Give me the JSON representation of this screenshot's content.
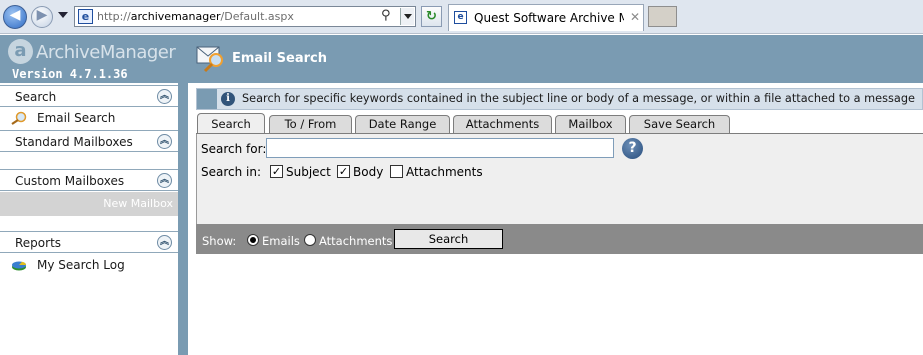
{
  "browser": {
    "url_prefix": "http://",
    "url_host": "archivemanager",
    "url_path": "/Default.aspx",
    "tab_title": "Quest Software Archive Man...",
    "tab_close": "✕"
  },
  "app": {
    "logo_letter": "a",
    "logo_name": "ArchiveManager",
    "version": "Version 4.7.1.36",
    "page_title": "Email Search"
  },
  "sidebar": {
    "sections": [
      {
        "label": "Search",
        "items": [
          {
            "label": "Email Search",
            "icon": "magnifier-icon"
          }
        ]
      },
      {
        "label": "Standard Mailboxes",
        "items": []
      },
      {
        "label": "Custom Mailboxes",
        "items": [
          {
            "label": "New Mailbox"
          }
        ]
      },
      {
        "label": "Reports",
        "items": [
          {
            "label": "My Search Log",
            "icon": "report-icon"
          }
        ]
      }
    ],
    "collapse_glyph": "︽"
  },
  "main": {
    "info_text": "Search for specific keywords contained in the subject line or body of a message, or within a file attached to a message",
    "tabs": [
      {
        "label": "Search",
        "active": true
      },
      {
        "label": "To / From",
        "active": false
      },
      {
        "label": "Date Range",
        "active": false
      },
      {
        "label": "Attachments",
        "active": false
      },
      {
        "label": "Mailbox",
        "active": false
      },
      {
        "label": "Save Search",
        "active": false
      }
    ],
    "form": {
      "search_for_label": "Search for:",
      "search_for_value": "",
      "help_glyph": "?",
      "search_in_label": "Search in:",
      "checkboxes": [
        {
          "label": "Subject",
          "checked": true
        },
        {
          "label": "Body",
          "checked": true
        },
        {
          "label": "Attachments",
          "checked": false
        }
      ]
    },
    "show": {
      "label": "Show:",
      "options": [
        {
          "label": "Emails",
          "selected": true
        },
        {
          "label": "Attachments",
          "selected": false
        }
      ],
      "search_button": "Search"
    }
  },
  "colors": {
    "header": "#7a9bb2",
    "info_bar": "#d6e0ea",
    "show_bar": "#8a8a8a"
  }
}
